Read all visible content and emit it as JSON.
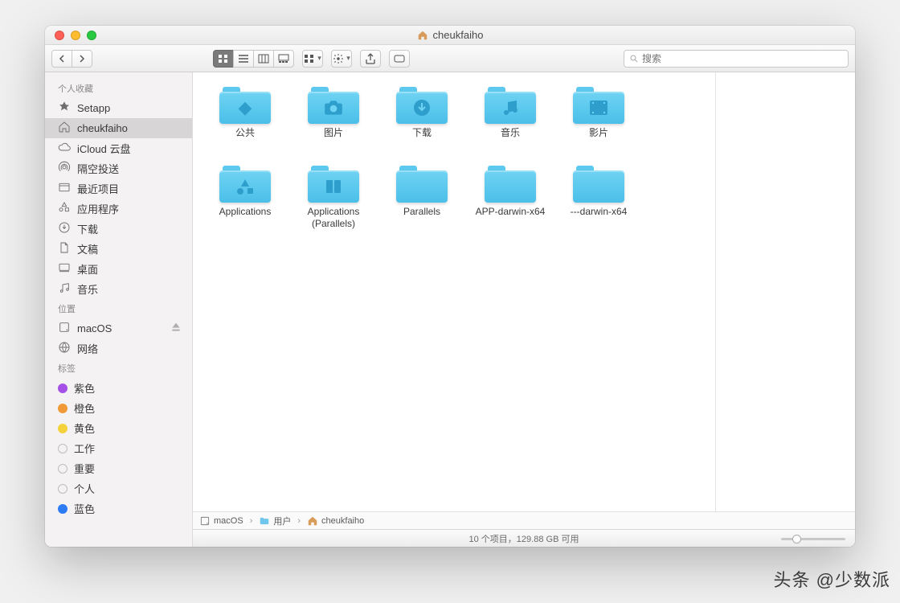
{
  "window": {
    "title": "cheukfaiho"
  },
  "toolbar": {
    "search_placeholder": "搜索"
  },
  "sidebar": {
    "sections": [
      {
        "header": "个人收藏",
        "items": [
          {
            "icon": "setapp",
            "label": "Setapp"
          },
          {
            "icon": "home",
            "label": "cheukfaiho",
            "selected": true
          },
          {
            "icon": "cloud",
            "label": "iCloud 云盘"
          },
          {
            "icon": "airdrop",
            "label": "隔空投送"
          },
          {
            "icon": "recent",
            "label": "最近项目"
          },
          {
            "icon": "apps",
            "label": "应用程序"
          },
          {
            "icon": "downloads",
            "label": "下载"
          },
          {
            "icon": "documents",
            "label": "文稿"
          },
          {
            "icon": "desktop",
            "label": "桌面"
          },
          {
            "icon": "music",
            "label": "音乐"
          }
        ]
      },
      {
        "header": "位置",
        "items": [
          {
            "icon": "disk",
            "label": "macOS",
            "ejectable": true
          },
          {
            "icon": "network",
            "label": "网络"
          }
        ]
      },
      {
        "header": "标签",
        "items": [
          {
            "icon": "tag",
            "color": "#a550e6",
            "label": "紫色"
          },
          {
            "icon": "tag",
            "color": "#f09a37",
            "label": "橙色"
          },
          {
            "icon": "tag",
            "color": "#f3d23b",
            "label": "黄色"
          },
          {
            "icon": "tag",
            "color": "transparent",
            "outline": true,
            "label": "工作"
          },
          {
            "icon": "tag",
            "color": "transparent",
            "outline": true,
            "label": "重要"
          },
          {
            "icon": "tag",
            "color": "transparent",
            "outline": true,
            "label": "个人"
          },
          {
            "icon": "tag",
            "color": "#2e7bf6",
            "label": "蓝色"
          }
        ]
      }
    ]
  },
  "items": [
    {
      "label": "公共",
      "glyph": "◆"
    },
    {
      "label": "图片",
      "glyph": "camera"
    },
    {
      "label": "下载",
      "glyph": "download"
    },
    {
      "label": "音乐",
      "glyph": "music"
    },
    {
      "label": "影片",
      "glyph": "video"
    },
    {
      "label": "Applications",
      "glyph": "apps"
    },
    {
      "label": "Applications (Parallels)",
      "glyph": "apps-alt"
    },
    {
      "label": "Parallels",
      "glyph": ""
    },
    {
      "label": "APP-darwin-x64",
      "glyph": ""
    },
    {
      "label": "---darwin-x64",
      "glyph": ""
    }
  ],
  "path": [
    {
      "icon": "disk",
      "label": "macOS"
    },
    {
      "icon": "folder",
      "label": "用户"
    },
    {
      "icon": "home",
      "label": "cheukfaiho"
    }
  ],
  "status": "10 个项目，129.88 GB 可用",
  "watermark": "头条 @少数派"
}
